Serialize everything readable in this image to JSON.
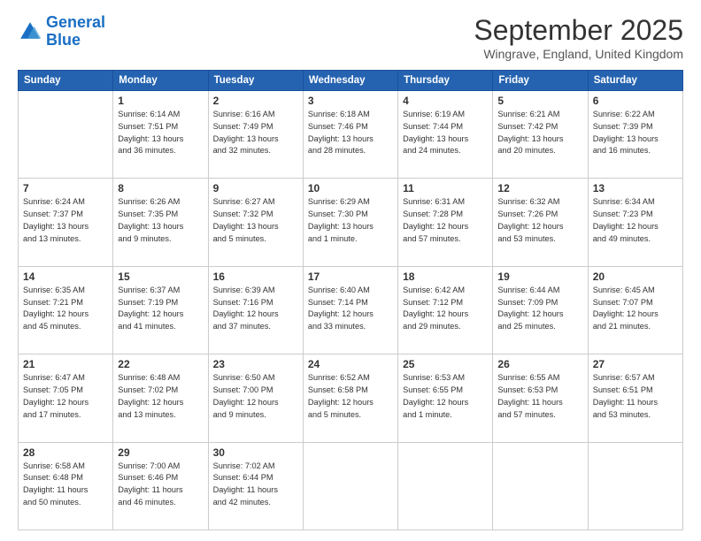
{
  "header": {
    "logo_general": "General",
    "logo_blue": "Blue",
    "month": "September 2025",
    "location": "Wingrave, England, United Kingdom"
  },
  "days_header": [
    "Sunday",
    "Monday",
    "Tuesday",
    "Wednesday",
    "Thursday",
    "Friday",
    "Saturday"
  ],
  "weeks": [
    [
      {
        "day": "",
        "info": ""
      },
      {
        "day": "1",
        "info": "Sunrise: 6:14 AM\nSunset: 7:51 PM\nDaylight: 13 hours\nand 36 minutes."
      },
      {
        "day": "2",
        "info": "Sunrise: 6:16 AM\nSunset: 7:49 PM\nDaylight: 13 hours\nand 32 minutes."
      },
      {
        "day": "3",
        "info": "Sunrise: 6:18 AM\nSunset: 7:46 PM\nDaylight: 13 hours\nand 28 minutes."
      },
      {
        "day": "4",
        "info": "Sunrise: 6:19 AM\nSunset: 7:44 PM\nDaylight: 13 hours\nand 24 minutes."
      },
      {
        "day": "5",
        "info": "Sunrise: 6:21 AM\nSunset: 7:42 PM\nDaylight: 13 hours\nand 20 minutes."
      },
      {
        "day": "6",
        "info": "Sunrise: 6:22 AM\nSunset: 7:39 PM\nDaylight: 13 hours\nand 16 minutes."
      }
    ],
    [
      {
        "day": "7",
        "info": "Sunrise: 6:24 AM\nSunset: 7:37 PM\nDaylight: 13 hours\nand 13 minutes."
      },
      {
        "day": "8",
        "info": "Sunrise: 6:26 AM\nSunset: 7:35 PM\nDaylight: 13 hours\nand 9 minutes."
      },
      {
        "day": "9",
        "info": "Sunrise: 6:27 AM\nSunset: 7:32 PM\nDaylight: 13 hours\nand 5 minutes."
      },
      {
        "day": "10",
        "info": "Sunrise: 6:29 AM\nSunset: 7:30 PM\nDaylight: 13 hours\nand 1 minute."
      },
      {
        "day": "11",
        "info": "Sunrise: 6:31 AM\nSunset: 7:28 PM\nDaylight: 12 hours\nand 57 minutes."
      },
      {
        "day": "12",
        "info": "Sunrise: 6:32 AM\nSunset: 7:26 PM\nDaylight: 12 hours\nand 53 minutes."
      },
      {
        "day": "13",
        "info": "Sunrise: 6:34 AM\nSunset: 7:23 PM\nDaylight: 12 hours\nand 49 minutes."
      }
    ],
    [
      {
        "day": "14",
        "info": "Sunrise: 6:35 AM\nSunset: 7:21 PM\nDaylight: 12 hours\nand 45 minutes."
      },
      {
        "day": "15",
        "info": "Sunrise: 6:37 AM\nSunset: 7:19 PM\nDaylight: 12 hours\nand 41 minutes."
      },
      {
        "day": "16",
        "info": "Sunrise: 6:39 AM\nSunset: 7:16 PM\nDaylight: 12 hours\nand 37 minutes."
      },
      {
        "day": "17",
        "info": "Sunrise: 6:40 AM\nSunset: 7:14 PM\nDaylight: 12 hours\nand 33 minutes."
      },
      {
        "day": "18",
        "info": "Sunrise: 6:42 AM\nSunset: 7:12 PM\nDaylight: 12 hours\nand 29 minutes."
      },
      {
        "day": "19",
        "info": "Sunrise: 6:44 AM\nSunset: 7:09 PM\nDaylight: 12 hours\nand 25 minutes."
      },
      {
        "day": "20",
        "info": "Sunrise: 6:45 AM\nSunset: 7:07 PM\nDaylight: 12 hours\nand 21 minutes."
      }
    ],
    [
      {
        "day": "21",
        "info": "Sunrise: 6:47 AM\nSunset: 7:05 PM\nDaylight: 12 hours\nand 17 minutes."
      },
      {
        "day": "22",
        "info": "Sunrise: 6:48 AM\nSunset: 7:02 PM\nDaylight: 12 hours\nand 13 minutes."
      },
      {
        "day": "23",
        "info": "Sunrise: 6:50 AM\nSunset: 7:00 PM\nDaylight: 12 hours\nand 9 minutes."
      },
      {
        "day": "24",
        "info": "Sunrise: 6:52 AM\nSunset: 6:58 PM\nDaylight: 12 hours\nand 5 minutes."
      },
      {
        "day": "25",
        "info": "Sunrise: 6:53 AM\nSunset: 6:55 PM\nDaylight: 12 hours\nand 1 minute."
      },
      {
        "day": "26",
        "info": "Sunrise: 6:55 AM\nSunset: 6:53 PM\nDaylight: 11 hours\nand 57 minutes."
      },
      {
        "day": "27",
        "info": "Sunrise: 6:57 AM\nSunset: 6:51 PM\nDaylight: 11 hours\nand 53 minutes."
      }
    ],
    [
      {
        "day": "28",
        "info": "Sunrise: 6:58 AM\nSunset: 6:48 PM\nDaylight: 11 hours\nand 50 minutes."
      },
      {
        "day": "29",
        "info": "Sunrise: 7:00 AM\nSunset: 6:46 PM\nDaylight: 11 hours\nand 46 minutes."
      },
      {
        "day": "30",
        "info": "Sunrise: 7:02 AM\nSunset: 6:44 PM\nDaylight: 11 hours\nand 42 minutes."
      },
      {
        "day": "",
        "info": ""
      },
      {
        "day": "",
        "info": ""
      },
      {
        "day": "",
        "info": ""
      },
      {
        "day": "",
        "info": ""
      }
    ]
  ]
}
